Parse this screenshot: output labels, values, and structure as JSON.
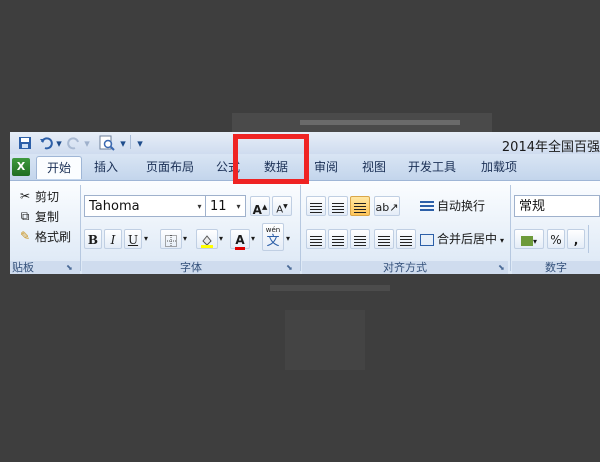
{
  "window": {
    "doc_title": "2014年全国百强",
    "tab_data_label": "数据"
  },
  "tabs": [
    {
      "label": "开始",
      "active": true
    },
    {
      "label": "插入"
    },
    {
      "label": "页面布局"
    },
    {
      "label": "公式"
    },
    {
      "label": "数据"
    },
    {
      "label": "审阅"
    },
    {
      "label": "视图"
    },
    {
      "label": "开发工具"
    },
    {
      "label": "加载项"
    }
  ],
  "clipboard": {
    "cut": "剪切",
    "copy": "复制",
    "painter": "格式刷",
    "group_label": "贴板"
  },
  "font": {
    "name": "Tahoma",
    "size": "11",
    "group_label": "字体",
    "grow": "A",
    "shrink": "A",
    "bold": "B",
    "italic": "I",
    "underline": "U",
    "color_a": "A",
    "phonetic": "文",
    "phonetic_top": "wén"
  },
  "alignment": {
    "wrap": "自动换行",
    "merge": "合并后居中",
    "group_label": "对齐方式"
  },
  "number": {
    "format": "常规",
    "percent": "%",
    "comma": ",",
    "group_label": "数字"
  },
  "colors": {
    "highlight": "#ef2323",
    "fill_yellow": "#ffff00",
    "font_red": "#e00000",
    "excel_green": "#2f8a30"
  },
  "icons": [
    "excel-icon",
    "save-icon",
    "undo-icon",
    "redo-icon",
    "print-preview-icon",
    "cut-icon",
    "copy-icon",
    "format-painter-icon",
    "border-icon",
    "fill-color-icon",
    "font-color-icon",
    "phonetic-icon",
    "align-icon",
    "wrap-text-icon",
    "merge-center-icon",
    "currency-icon",
    "dropdown-icon",
    "launcher-icon"
  ]
}
